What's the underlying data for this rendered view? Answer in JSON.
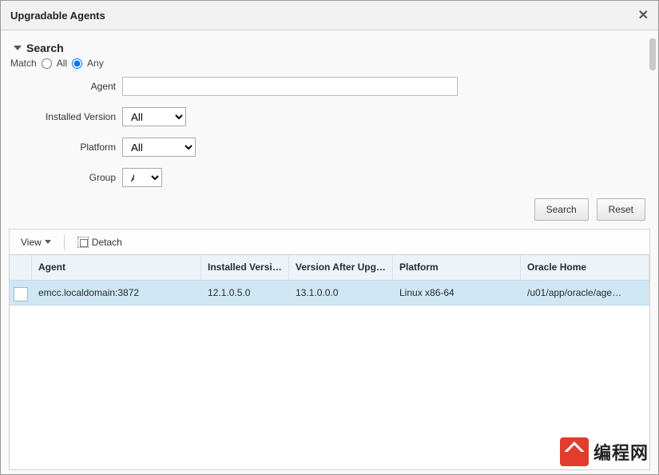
{
  "dialog": {
    "title": "Upgradable Agents"
  },
  "search": {
    "header": "Search",
    "match_label": "Match",
    "match_all": "All",
    "match_any": "Any",
    "fields": {
      "agent_label": "Agent",
      "installed_version_label": "Installed Version",
      "installed_version_value": "All",
      "platform_label": "Platform",
      "platform_value": "All",
      "group_label": "Group",
      "group_value": "All"
    },
    "buttons": {
      "search": "Search",
      "reset": "Reset"
    }
  },
  "toolbar": {
    "view": "View",
    "detach": "Detach"
  },
  "grid": {
    "columns": {
      "agent": "Agent",
      "installed_version": "Installed Version",
      "version_after": "Version After Upgrade",
      "platform": "Platform",
      "oracle_home": "Oracle Home"
    },
    "rows": [
      {
        "agent": "emcc.localdomain:3872",
        "installed_version": "12.1.0.5.0",
        "version_after": "13.1.0.0.0",
        "platform": "Linux x86-64",
        "oracle_home": "/u01/app/oracle/age…"
      }
    ]
  },
  "watermark": {
    "text": "编程网"
  }
}
